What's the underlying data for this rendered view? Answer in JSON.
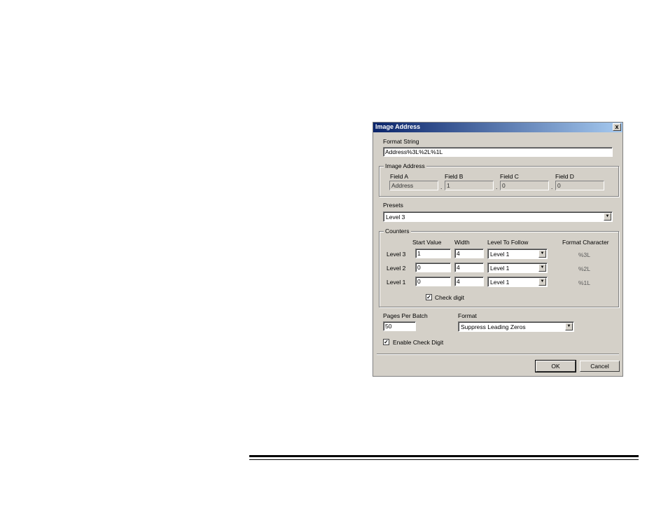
{
  "dialog": {
    "title": "Image Address",
    "close_glyph": "x",
    "format_string": {
      "label": "Format String",
      "value": "Address%3L%2L%1L"
    },
    "image_address": {
      "group_label": "Image Address",
      "fields": [
        {
          "label": "Field A",
          "value": "Address"
        },
        {
          "label": "Field B",
          "value": "1"
        },
        {
          "label": "Field C",
          "value": "0"
        },
        {
          "label": "Field D",
          "value": "0"
        }
      ],
      "separator": "."
    },
    "presets": {
      "label": "Presets",
      "value": "Level 3"
    },
    "counters": {
      "group_label": "Counters",
      "headers": {
        "start": "Start Value",
        "width": "Width",
        "follow": "Level To Follow",
        "format_char": "Format Character"
      },
      "rows": [
        {
          "level": "Level 3",
          "start": "1",
          "width": "4",
          "follow": "Level 1",
          "format_char": "%3L"
        },
        {
          "level": "Level 2",
          "start": "0",
          "width": "4",
          "follow": "Level 1",
          "format_char": "%2L"
        },
        {
          "level": "Level 1",
          "start": "0",
          "width": "4",
          "follow": "Level 1",
          "format_char": "%1L"
        }
      ],
      "check_digit": {
        "label": "Check digit",
        "checked": true
      }
    },
    "pages_per_batch": {
      "label": "Pages Per Batch",
      "value": "50"
    },
    "format": {
      "label": "Format",
      "value": "Suppress Leading Zeros"
    },
    "enable_check_digit": {
      "label": "Enable Check Digit",
      "checked": true
    },
    "buttons": {
      "ok": "OK",
      "cancel": "Cancel"
    },
    "check_mark": "✓",
    "dropdown_arrow": "▼"
  }
}
